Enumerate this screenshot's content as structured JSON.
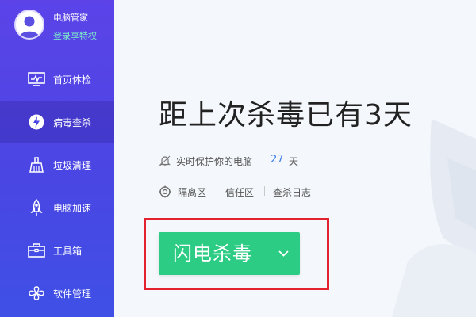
{
  "profile": {
    "name": "电脑管家",
    "login_link": "登录享特权"
  },
  "sidebar": {
    "items": [
      {
        "label": "首页体检",
        "icon": "monitor-icon",
        "active": false
      },
      {
        "label": "病毒查杀",
        "icon": "lightning-shield-icon",
        "active": true
      },
      {
        "label": "垃圾清理",
        "icon": "broom-icon",
        "active": false
      },
      {
        "label": "电脑加速",
        "icon": "rocket-icon",
        "active": false
      },
      {
        "label": "工具箱",
        "icon": "toolbox-icon",
        "active": false
      },
      {
        "label": "软件管理",
        "icon": "software-icon",
        "active": false
      }
    ]
  },
  "main": {
    "headline": "距上次杀毒已有3天",
    "protection": {
      "text": "实时保护你的电脑",
      "days": "27",
      "unit": "天"
    },
    "links": [
      "隔离区",
      "信任区",
      "查杀日志"
    ],
    "scan_button": {
      "label": "闪电杀毒",
      "dropdown_icon": "chevron-down-icon"
    }
  },
  "colors": {
    "sidebar_top": "#5b43e8",
    "sidebar_bottom": "#3f50e6",
    "accent_green": "#2dcc84",
    "highlight_red": "#e2222f",
    "login_green": "#7ff0c8",
    "days_blue": "#3b7de8"
  }
}
